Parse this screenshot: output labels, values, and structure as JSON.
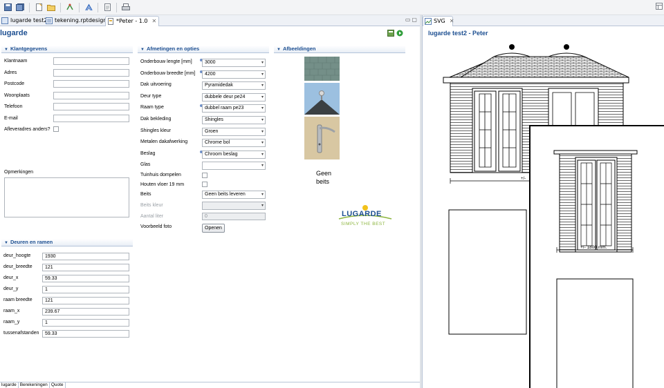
{
  "toolbar": {
    "icons": [
      "save-icon",
      "save-all-icon",
      "new-icon",
      "open-folder-icon",
      "run-icon",
      "report-icon",
      "page-icon",
      "print-icon"
    ]
  },
  "editor_tabs": [
    {
      "label": "lugarde test2",
      "icon": "report-icon"
    },
    {
      "label": "tekening.rptdesign",
      "icon": "report-design-icon"
    },
    {
      "label": "*Peter - 1.0",
      "icon": "document-icon",
      "active": true
    }
  ],
  "form": {
    "title": "lugarde",
    "klant": {
      "title": "Klantgegevens",
      "fields": [
        {
          "label": "Klantnaam",
          "value": ""
        },
        {
          "label": "Adres",
          "value": ""
        },
        {
          "label": "Postcode",
          "value": ""
        },
        {
          "label": "Woonplaats",
          "value": ""
        },
        {
          "label": "Telefoon",
          "value": ""
        },
        {
          "label": "E-mail",
          "value": ""
        }
      ],
      "aflever_label": "Afleveradres anders?",
      "opmerkingen_label": "Opmerkingen"
    },
    "afmetingen": {
      "title": "Afmetingen en opties",
      "rows": [
        {
          "label": "Onderbouw lengte [mm]",
          "value": "3000",
          "info": true
        },
        {
          "label": "Onderbouw breedte [mm]",
          "value": "4200",
          "info": true
        },
        {
          "label": "Dak uitvoering",
          "value": "Pyramidedak"
        },
        {
          "label": "Deur type",
          "value": "dubbele deur pe24"
        },
        {
          "label": "Raam type",
          "value": "dubbel raam pe23",
          "info": true
        },
        {
          "label": "Dak bekleding",
          "value": "Shingles"
        },
        {
          "label": "Shingles kleur",
          "value": "Groen"
        },
        {
          "label": "Metalen dakafwerking",
          "value": "Chrome bol"
        },
        {
          "label": "Beslag",
          "value": "Chroom beslag",
          "info": true
        },
        {
          "label": "Glas",
          "value": ""
        }
      ],
      "tuinhuis_label": "Tuinhuis dompelen",
      "houten_label": "Houten vloer 19 mm",
      "beits_label": "Beits",
      "beits_value": "Geen beits leveren",
      "beits_kleur_label": "Beits kleur",
      "aantal_label": "Aantal liter",
      "aantal_value": "0",
      "foto_label": "Voorbeeld foto",
      "foto_button": "Openen"
    },
    "afbeeldingen": {
      "title": "Afbeeldingen",
      "geen_beits": "Geen\nbeits",
      "logo_text": "LUGARDE",
      "logo_tagline": "SIMPLY THE BEST"
    },
    "deuren": {
      "title": "Deuren en ramen",
      "fields": [
        {
          "label": "deur_hoogte",
          "value": "1930"
        },
        {
          "label": "deur_breedte",
          "value": "121"
        },
        {
          "label": "deur_x",
          "value": "59.33"
        },
        {
          "label": "deur_y",
          "value": "1"
        },
        {
          "label": "raam breedte",
          "value": "121"
        },
        {
          "label": "raam_x",
          "value": "239.67"
        },
        {
          "label": "raam_y",
          "value": "1"
        },
        {
          "label": "tussenafstanden",
          "value": "59.33"
        }
      ]
    },
    "bottom_tabs": [
      "lugarde",
      "Berekeningen",
      "Quote"
    ]
  },
  "svg_view": {
    "tab_label": "SVG",
    "title": "lugarde test2 - Peter",
    "dim_left": "+/-",
    "dim_right": "+/- 1800 mm."
  }
}
